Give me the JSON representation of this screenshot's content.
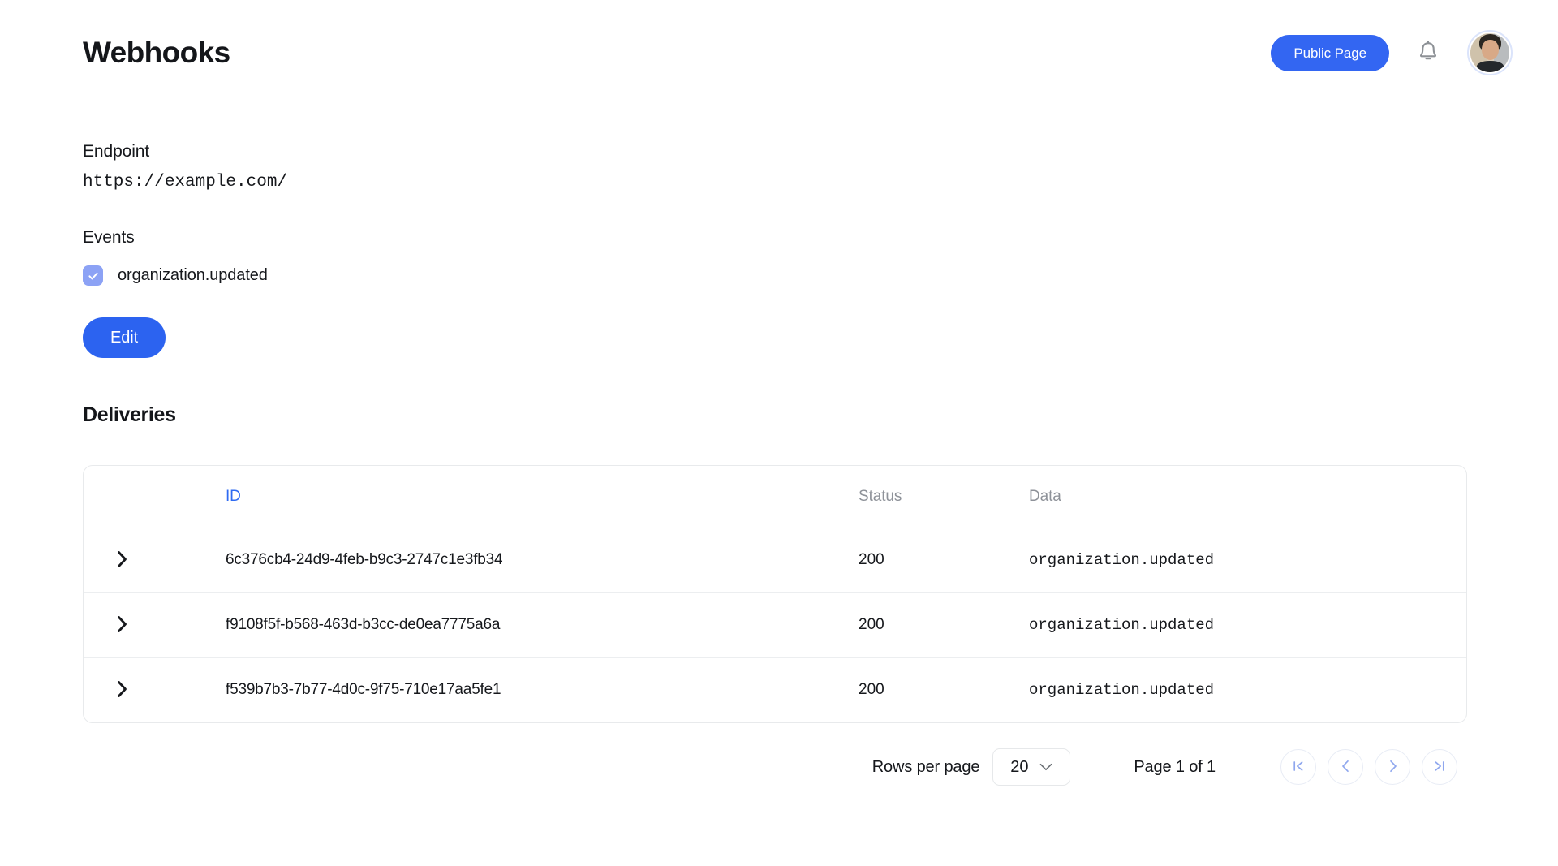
{
  "header": {
    "title": "Webhooks",
    "public_page_label": "Public Page",
    "notifications_icon": "bell-icon",
    "avatar_icon": "user-avatar"
  },
  "details": {
    "endpoint_label": "Endpoint",
    "endpoint_value": "https://example.com/",
    "events_label": "Events",
    "events": [
      {
        "label": "organization.updated",
        "checked": true
      }
    ],
    "edit_label": "Edit"
  },
  "deliveries": {
    "section_title": "Deliveries",
    "columns": [
      {
        "key": "expand",
        "label": ""
      },
      {
        "key": "id",
        "label": "ID",
        "sorted": true
      },
      {
        "key": "status",
        "label": "Status",
        "sorted": false
      },
      {
        "key": "data",
        "label": "Data",
        "sorted": false
      }
    ],
    "rows": [
      {
        "id": "6c376cb4-24d9-4feb-b9c3-2747c1e3fb34",
        "status": "200",
        "data": "organization.updated"
      },
      {
        "id": "f9108f5f-b568-463d-b3cc-de0ea7775a6a",
        "status": "200",
        "data": "organization.updated"
      },
      {
        "id": "f539b7b3-7b77-4d0c-9f75-710e17aa5fe1",
        "status": "200",
        "data": "organization.updated"
      }
    ]
  },
  "pagination": {
    "rows_per_page_label": "Rows per page",
    "rows_per_page_value": "20",
    "rows_per_page_options": [
      "20"
    ],
    "page_indicator": "Page 1 of 1",
    "first_page_icon": "first-page-icon",
    "prev_page_icon": "previous-page-icon",
    "next_page_icon": "next-page-icon",
    "last_page_icon": "last-page-icon"
  },
  "colors": {
    "accent_blue": "#3366f2",
    "edit_blue": "#2c63f0",
    "checkbox_blue": "#8ca2f5",
    "status_green": "#2e8b45",
    "sorted_header_blue": "#2f6bf2",
    "muted_text": "#8e9299",
    "border": "#e8eaec"
  }
}
